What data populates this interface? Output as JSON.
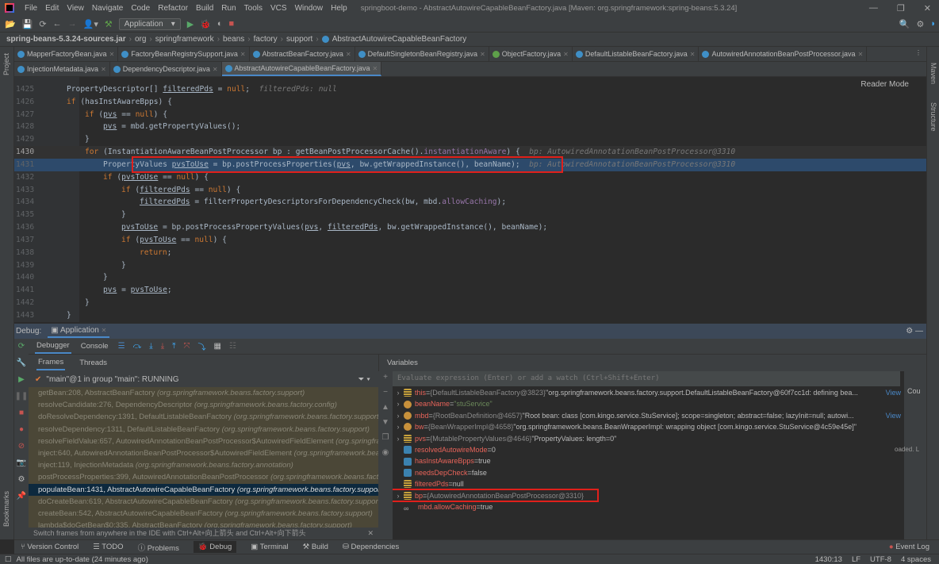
{
  "title_bar": {
    "menus": [
      "File",
      "Edit",
      "View",
      "Navigate",
      "Code",
      "Refactor",
      "Build",
      "Run",
      "Tools",
      "VCS",
      "Window",
      "Help"
    ],
    "window_title": "springboot-demo - AbstractAutowireCapableBeanFactory.java [Maven: org.springframework:spring-beans:5.3.24]"
  },
  "toolbar": {
    "run_config": "Application"
  },
  "breadcrumb": [
    "spring-beans-5.3.24-sources.jar",
    "org",
    "springframework",
    "beans",
    "factory",
    "support",
    "AbstractAutowireCapableBeanFactory"
  ],
  "tabs_row1": [
    {
      "label": "MapperFactoryBean.java",
      "icon": "class"
    },
    {
      "label": "FactoryBeanRegistrySupport.java",
      "icon": "class"
    },
    {
      "label": "AbstractBeanFactory.java",
      "icon": "class"
    },
    {
      "label": "DefaultSingletonBeanRegistry.java",
      "icon": "class"
    },
    {
      "label": "ObjectFactory.java",
      "icon": "interface"
    },
    {
      "label": "DefaultListableBeanFactory.java",
      "icon": "class"
    },
    {
      "label": "AutowiredAnnotationBeanPostProcessor.java",
      "icon": "class"
    }
  ],
  "tabs_row2": [
    {
      "label": "InjectionMetadata.java",
      "icon": "class"
    },
    {
      "label": "DependencyDescriptor.java",
      "icon": "class"
    },
    {
      "label": "AbstractAutowireCapableBeanFactory.java",
      "icon": "class",
      "active": true
    }
  ],
  "side": {
    "project": "Project",
    "maven": "Maven",
    "structure": "Structure",
    "bookmarks": "Bookmarks"
  },
  "editor": {
    "reader_mode": "Reader Mode",
    "lines": [
      {
        "n": "1425",
        "indent": 2,
        "seg": [
          [
            "PropertyDescriptor[] ",
            ""
          ],
          [
            "filteredPds",
            "ul"
          ],
          [
            " = ",
            ""
          ],
          [
            "null",
            "kw"
          ],
          [
            ";",
            ""
          ],
          [
            "  filteredPds: null",
            "hint"
          ]
        ]
      },
      {
        "n": "1426",
        "indent": 2,
        "seg": [
          [
            "if",
            "kw"
          ],
          [
            " (hasInstAwareBpps) {",
            ""
          ]
        ]
      },
      {
        "n": "1427",
        "indent": 3,
        "seg": [
          [
            "if",
            "kw"
          ],
          [
            " (",
            ""
          ],
          [
            "pvs",
            "ul"
          ],
          [
            " == ",
            ""
          ],
          [
            "null",
            "kw"
          ],
          [
            ") {",
            ""
          ]
        ]
      },
      {
        "n": "1428",
        "indent": 4,
        "seg": [
          [
            "pvs",
            "ul"
          ],
          [
            " = mbd.getPropertyValues();",
            ""
          ]
        ]
      },
      {
        "n": "1429",
        "indent": 3,
        "seg": [
          [
            "}",
            ""
          ]
        ]
      },
      {
        "n": "1430",
        "indent": 3,
        "cur": true,
        "seg": [
          [
            "for",
            "kw"
          ],
          [
            " (InstantiationAwareBeanPostProcessor bp : getBeanPostProcessorCache().",
            ""
          ],
          [
            "instantiationAware",
            "fld"
          ],
          [
            ") {",
            ""
          ],
          [
            "  bp: AutowiredAnnotationBeanPostProcessor@3310",
            "hint"
          ]
        ]
      },
      {
        "n": "1431",
        "indent": 4,
        "exec": true,
        "seg": [
          [
            "PropertyValues ",
            ""
          ],
          [
            "pvsToUse",
            "ul"
          ],
          [
            " = bp.postProcessProperties(",
            ""
          ],
          [
            "pvs",
            "ul"
          ],
          [
            ", bw.getWrappedInstance(), beanName);",
            ""
          ],
          [
            "  bp: AutowiredAnnotationBeanPostProcessor@3310",
            "hint"
          ]
        ]
      },
      {
        "n": "1432",
        "indent": 4,
        "seg": [
          [
            "if",
            "kw"
          ],
          [
            " (",
            ""
          ],
          [
            "pvsToUse",
            "ul"
          ],
          [
            " == ",
            ""
          ],
          [
            "null",
            "kw"
          ],
          [
            ") {",
            ""
          ]
        ]
      },
      {
        "n": "1433",
        "indent": 5,
        "seg": [
          [
            "if",
            "kw"
          ],
          [
            " (",
            ""
          ],
          [
            "filteredPds",
            "ul"
          ],
          [
            " == ",
            ""
          ],
          [
            "null",
            "kw"
          ],
          [
            ") {",
            ""
          ]
        ]
      },
      {
        "n": "1434",
        "indent": 6,
        "seg": [
          [
            "filteredPds",
            "ul"
          ],
          [
            " = filterPropertyDescriptorsForDependencyCheck(bw, mbd.",
            ""
          ],
          [
            "allowCaching",
            "fld"
          ],
          [
            ");",
            ""
          ]
        ]
      },
      {
        "n": "1435",
        "indent": 5,
        "seg": [
          [
            "}",
            ""
          ]
        ]
      },
      {
        "n": "1436",
        "indent": 5,
        "seg": [
          [
            "pvsToUse",
            "ul"
          ],
          [
            " = bp.postProcessPropertyValues(",
            ""
          ],
          [
            "pvs",
            "ul"
          ],
          [
            ", ",
            ""
          ],
          [
            "filteredPds",
            "ul"
          ],
          [
            ", bw.getWrappedInstance(), beanName);",
            ""
          ]
        ]
      },
      {
        "n": "1437",
        "indent": 5,
        "seg": [
          [
            "if",
            "kw"
          ],
          [
            " (",
            ""
          ],
          [
            "pvsToUse",
            "ul"
          ],
          [
            " == ",
            ""
          ],
          [
            "null",
            "kw"
          ],
          [
            ") {",
            ""
          ]
        ]
      },
      {
        "n": "1438",
        "indent": 6,
        "seg": [
          [
            "return",
            "kw"
          ],
          [
            ";",
            ""
          ]
        ]
      },
      {
        "n": "1439",
        "indent": 5,
        "seg": [
          [
            "}",
            ""
          ]
        ]
      },
      {
        "n": "1440",
        "indent": 4,
        "seg": [
          [
            "}",
            ""
          ]
        ]
      },
      {
        "n": "1441",
        "indent": 4,
        "seg": [
          [
            "pvs",
            "ul"
          ],
          [
            " = ",
            ""
          ],
          [
            "pvsToUse",
            "ul"
          ],
          [
            ";",
            ""
          ]
        ]
      },
      {
        "n": "1442",
        "indent": 3,
        "seg": [
          [
            "}",
            ""
          ]
        ]
      },
      {
        "n": "1443",
        "indent": 2,
        "seg": [
          [
            "}",
            ""
          ]
        ]
      }
    ]
  },
  "debug": {
    "label": "Debug:",
    "session": "Application",
    "tabs": [
      "Debugger",
      "Console"
    ],
    "frames_tabs": [
      "Frames",
      "Threads"
    ],
    "variables_label": "Variables",
    "thread": "\"main\"@1 in group \"main\": RUNNING",
    "frames": [
      {
        "m": "getBean:208, AbstractBeanFactory",
        "p": "(org.springframework.beans.factory.support)"
      },
      {
        "m": "resolveCandidate:276, DependencyDescriptor",
        "p": "(org.springframework.beans.factory.config)"
      },
      {
        "m": "doResolveDependency:1391, DefaultListableBeanFactory",
        "p": "(org.springframework.beans.factory.support)"
      },
      {
        "m": "resolveDependency:1311, DefaultListableBeanFactory",
        "p": "(org.springframework.beans.factory.support)"
      },
      {
        "m": "resolveFieldValue:657, AutowiredAnnotationBeanPostProcessor$AutowiredFieldElement",
        "p": "(org.springframework.beans.factory.annotation)"
      },
      {
        "m": "inject:640, AutowiredAnnotationBeanPostProcessor$AutowiredFieldElement",
        "p": "(org.springframework.beans.factory.annotation)"
      },
      {
        "m": "inject:119, InjectionMetadata",
        "p": "(org.springframework.beans.factory.annotation)"
      },
      {
        "m": "postProcessProperties:399, AutowiredAnnotationBeanPostProcessor",
        "p": "(org.springframework.beans.factory.annotation)"
      },
      {
        "m": "populateBean:1431, AbstractAutowireCapableBeanFactory",
        "p": "(org.springframework.beans.factory.support)",
        "selected": true
      },
      {
        "m": "doCreateBean:619, AbstractAutowireCapableBeanFactory",
        "p": "(org.springframework.beans.factory.support)"
      },
      {
        "m": "createBean:542, AbstractAutowireCapableBeanFactory",
        "p": "(org.springframework.beans.factory.support)"
      },
      {
        "m": "lambda$doGetBean$0:335, AbstractBeanFactory",
        "p": "(org.springframework.beans.factory.support)"
      }
    ],
    "switch_hint": "Switch frames from anywhere in the IDE with Ctrl+Alt+向上箭头 and Ctrl+Alt+向下箭头",
    "eval_placeholder": "Evaluate expression (Enter) or add a watch (Ctrl+Shift+Enter)",
    "variables": [
      {
        "icon": "field",
        "exp": true,
        "name": "this",
        "type": "{DefaultListableBeanFactory@3823}",
        "val": "\"org.springframework.beans.factory.support.DefaultListableBeanFactory@60f7cc1d: defining bea...",
        "link": "View"
      },
      {
        "icon": "param",
        "exp": true,
        "name": "beanName",
        "type": "",
        "str": "\"stuService\""
      },
      {
        "icon": "param",
        "exp": true,
        "name": "mbd",
        "type": "{RootBeanDefinition@4657}",
        "val": "\"Root bean: class [com.kingo.service.StuService]; scope=singleton; abstract=false; lazyInit=null; autowi...",
        "link": "View"
      },
      {
        "icon": "param",
        "exp": true,
        "name": "bw",
        "type": "{BeanWrapperImpl@4658}",
        "val": "\"org.springframework.beans.BeanWrapperImpl: wrapping object [com.kingo.service.StuService@4c59e45e]\""
      },
      {
        "icon": "field",
        "exp": true,
        "name": "pvs",
        "type": "{MutablePropertyValues@4646}",
        "val": "\"PropertyValues: length=0\""
      },
      {
        "icon": "prim",
        "name": "resolvedAutowireMode",
        "val": "0"
      },
      {
        "icon": "prim",
        "name": "hasInstAwareBpps",
        "val": "true"
      },
      {
        "icon": "prim",
        "name": "needsDepCheck",
        "val": "false"
      },
      {
        "icon": "field",
        "name": "filteredPds",
        "val": "null"
      },
      {
        "icon": "field",
        "exp": true,
        "name": "bp",
        "type": "{AutowiredAnnotationBeanPostProcessor@3310}",
        "highlight": true
      },
      {
        "icon": "watch",
        "name": "mbd.allowCaching",
        "val": "true"
      }
    ],
    "right_col": {
      "text1": "Cou",
      "text2": "oaded. L"
    }
  },
  "bottom_bar": [
    "Version Control",
    "TODO",
    "Problems",
    "Debug",
    "Terminal",
    "Build",
    "Dependencies"
  ],
  "event_log": "Event Log",
  "status": {
    "message": "All files are up-to-date (24 minutes ago)",
    "position": "1430:13",
    "line_sep": "LF",
    "encoding": "UTF-8",
    "indent": "4 spaces"
  },
  "colors": {
    "keyword": "#cc7832",
    "field": "#9876aa",
    "exec_line": "#2d4a6b",
    "highlight_box": "#e0201b",
    "frames_bg": "#4b4737",
    "selected_frame": "#0d293e"
  }
}
